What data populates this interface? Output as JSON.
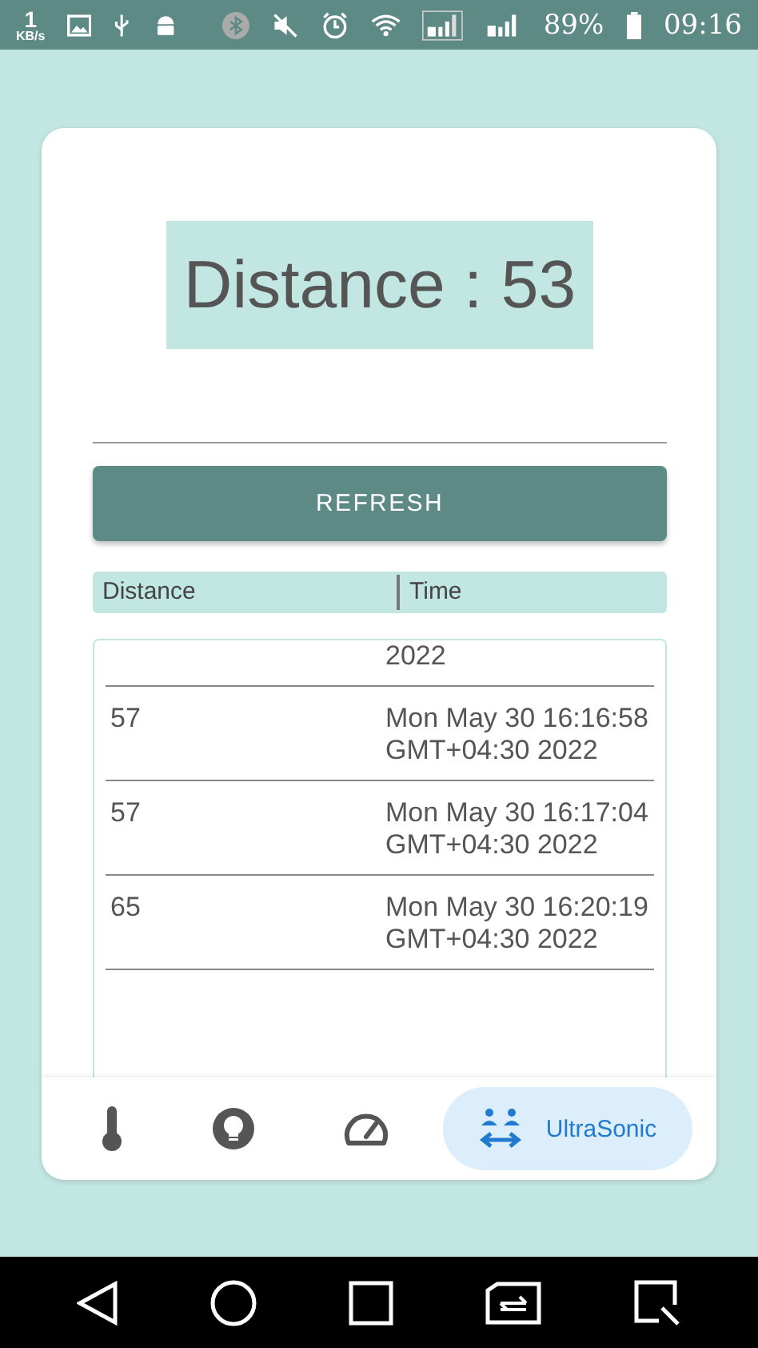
{
  "status_bar": {
    "speed": "1",
    "speed_unit": "KB/s",
    "battery": "89%",
    "time": "09:16"
  },
  "reading": {
    "label": "Distance : 53"
  },
  "refresh_button": "REFRESH",
  "table": {
    "columns": [
      "Distance",
      "Time"
    ],
    "rows": [
      {
        "distance": "",
        "time": "2022"
      },
      {
        "distance": "57",
        "time": "Mon May 30 16:16:58 GMT+04:30 2022"
      },
      {
        "distance": "57",
        "time": "Mon May 30 16:17:04 GMT+04:30 2022"
      },
      {
        "distance": "65",
        "time": "Mon May 30 16:20:19 GMT+04:30 2022"
      }
    ]
  },
  "bottom_nav": [
    {
      "kind": "thermometer",
      "selected": false
    },
    {
      "kind": "bulb",
      "selected": false
    },
    {
      "kind": "gauge",
      "selected": false
    },
    {
      "kind": "sonic",
      "label": "UltraSonic",
      "selected": true
    }
  ]
}
